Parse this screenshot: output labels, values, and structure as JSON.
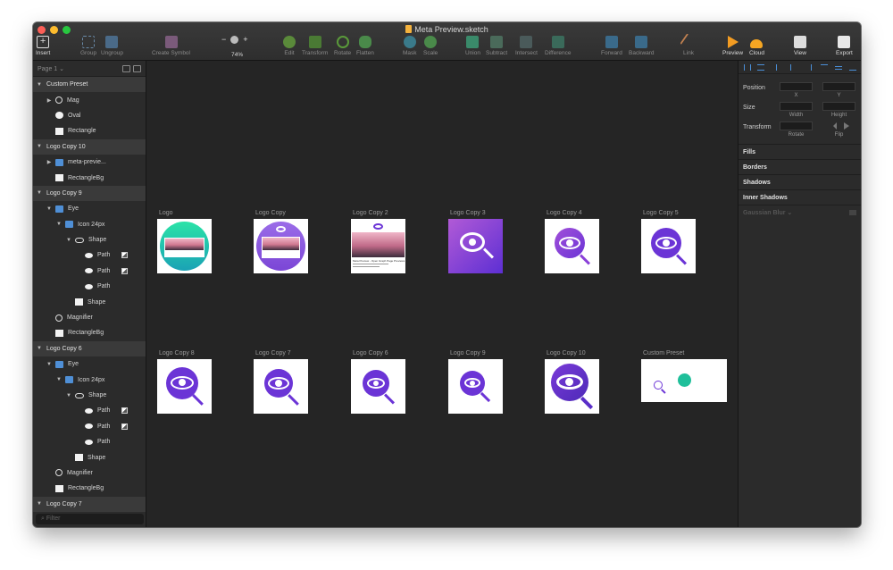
{
  "window": {
    "title": "Meta Preview.sketch"
  },
  "toolbar": {
    "insert": "Insert",
    "group": "Group",
    "ungroup": "Ungroup",
    "create_symbol": "Create Symbol",
    "zoom_out": "−",
    "zoom_level": "74%",
    "zoom_in": "+",
    "edit": "Edit",
    "transform": "Transform",
    "rotate": "Rotate",
    "flatten": "Flatten",
    "mask": "Mask",
    "scale": "Scale",
    "union": "Union",
    "subtract": "Subtract",
    "intersect": "Intersect",
    "difference": "Difference",
    "forward": "Forward",
    "backward": "Backward",
    "link": "Link",
    "preview": "Preview",
    "cloud": "Cloud",
    "view": "View",
    "export": "Export"
  },
  "sidebar": {
    "page_selector": "Page 1 ⌄",
    "filter_placeholder": "Filter",
    "layers": [
      {
        "label": "Custom Preset",
        "kind": "group",
        "icon": "none"
      },
      {
        "label": "Mag",
        "kind": "item",
        "icon": "magnifier-icon"
      },
      {
        "label": "Oval",
        "kind": "item",
        "icon": "oval-icon"
      },
      {
        "label": "Rectangle",
        "kind": "item",
        "icon": "rectangle-icon"
      },
      {
        "label": "Logo Copy 10",
        "kind": "group",
        "icon": "none"
      },
      {
        "label": "meta-previe...",
        "kind": "item",
        "icon": "folder-icon"
      },
      {
        "label": "RectangleBg",
        "kind": "item",
        "icon": "rectangle-icon"
      },
      {
        "label": "Logo Copy 9",
        "kind": "group",
        "icon": "none"
      },
      {
        "label": "Eye",
        "kind": "item",
        "icon": "folder-icon"
      },
      {
        "label": "Icon 24px",
        "kind": "item",
        "icon": "folder-icon"
      },
      {
        "label": "Shape",
        "kind": "item",
        "icon": "eye-icon"
      },
      {
        "label": "Path",
        "kind": "item",
        "icon": "path-icon"
      },
      {
        "label": "Path",
        "kind": "item",
        "icon": "path-icon"
      },
      {
        "label": "Path",
        "kind": "item",
        "icon": "path-icon"
      },
      {
        "label": "Shape",
        "kind": "item",
        "icon": "rectangle-icon"
      },
      {
        "label": "Magnifier",
        "kind": "item",
        "icon": "magnifier-icon"
      },
      {
        "label": "RectangleBg",
        "kind": "item",
        "icon": "rectangle-icon"
      },
      {
        "label": "Logo Copy 6",
        "kind": "group",
        "icon": "none"
      },
      {
        "label": "Eye",
        "kind": "item",
        "icon": "folder-icon"
      },
      {
        "label": "Icon 24px",
        "kind": "item",
        "icon": "folder-icon"
      },
      {
        "label": "Shape",
        "kind": "item",
        "icon": "eye-icon"
      },
      {
        "label": "Path",
        "kind": "item",
        "icon": "path-icon"
      },
      {
        "label": "Path",
        "kind": "item",
        "icon": "path-icon"
      },
      {
        "label": "Path",
        "kind": "item",
        "icon": "path-icon"
      },
      {
        "label": "Shape",
        "kind": "item",
        "icon": "rectangle-icon"
      },
      {
        "label": "Magnifier",
        "kind": "item",
        "icon": "magnifier-icon"
      },
      {
        "label": "RectangleBg",
        "kind": "item",
        "icon": "rectangle-icon"
      },
      {
        "label": "Logo Copy 7",
        "kind": "group",
        "icon": "none"
      }
    ]
  },
  "canvas": {
    "artboards": [
      {
        "name": "Logo",
        "style": "teal-photo"
      },
      {
        "name": "Logo Copy",
        "style": "purple-circle-photo"
      },
      {
        "name": "Logo Copy 2",
        "style": "photo-card"
      },
      {
        "name": "Logo Copy 3",
        "style": "purple-square"
      },
      {
        "name": "Logo Copy 4",
        "style": "purple-eye"
      },
      {
        "name": "Logo Copy 5",
        "style": "purple-eye"
      },
      {
        "name": "Logo Copy 8",
        "style": "purple-eye"
      },
      {
        "name": "Logo Copy 7",
        "style": "purple-eye"
      },
      {
        "name": "Logo Copy 6",
        "style": "purple-eye"
      },
      {
        "name": "Logo Copy 9",
        "style": "purple-eye"
      },
      {
        "name": "Logo Copy 10",
        "style": "purple-eye"
      },
      {
        "name": "Custom Preset",
        "style": "custom-preset"
      }
    ],
    "card_caption": "Meta Preview - Open Graph Page Previews"
  },
  "inspector": {
    "position": "Position",
    "x": "X",
    "y": "Y",
    "size": "Size",
    "width": "Width",
    "height": "Height",
    "transform": "Transform",
    "rotate": "Rotate",
    "flip": "Flip",
    "fills": "Fills",
    "borders": "Borders",
    "shadows": "Shadows",
    "inner_shadows": "Inner Shadows",
    "gaussian_blur": "Gaussian Blur ⌄"
  },
  "colors": {
    "purple": "#6b34d6",
    "purple_light": "#9b4fdd",
    "teal": "#1fd0a8",
    "folder_blue": "#4f8fd6",
    "accent_blue": "#4a8fd8"
  }
}
